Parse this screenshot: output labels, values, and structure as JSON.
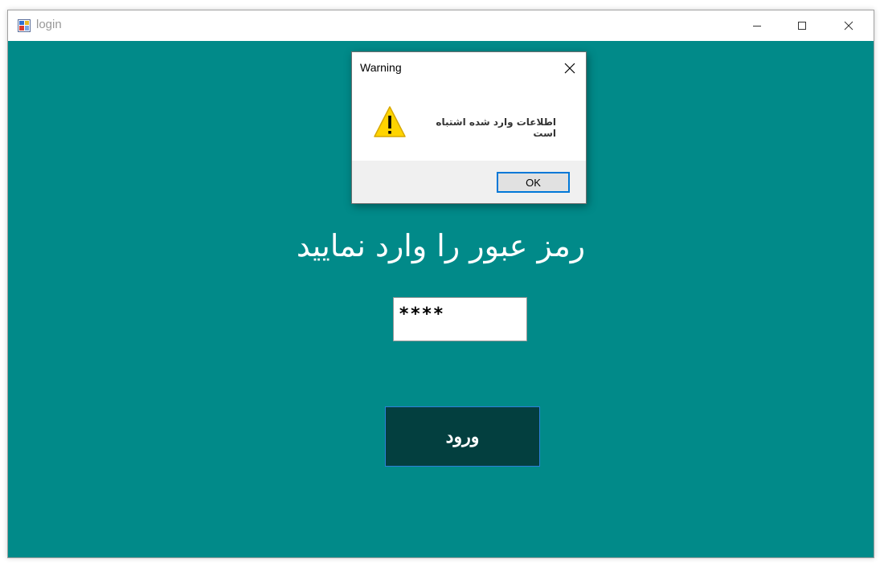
{
  "window": {
    "title": "login",
    "icon": "winforms-app-icon",
    "controls": {
      "minimize_icon": "minimize-icon",
      "maximize_icon": "maximize-icon",
      "close_icon": "close-icon"
    }
  },
  "form": {
    "background_color": "#018A89",
    "heading": "رمز عبور را وارد نمایید",
    "password_field": {
      "value": "****",
      "masked": true
    },
    "submit_label": "ورود",
    "submit_color": "#033F3F"
  },
  "dialog": {
    "title": "Warning",
    "icon": "warning-icon",
    "message": "اطلاعات وارد شده اشتباه است",
    "ok_label": "OK",
    "accent_color": "#0078D7"
  }
}
